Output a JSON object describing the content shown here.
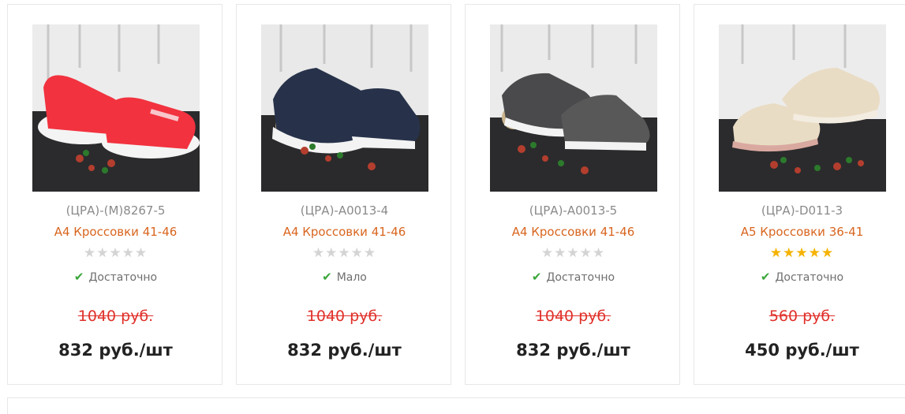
{
  "products": [
    {
      "sku": "(ЦРА)-(М)8267-5",
      "title": "А4 Кроссовки 41-46",
      "rating": 0,
      "stars_total": 5,
      "stock": "Достаточно",
      "old_price": "1040 руб.",
      "price": "832 руб./шт",
      "shoe_color": "#f2323f"
    },
    {
      "sku": "(ЦРА)-А0013-4",
      "title": "А4 Кроссовки 41-46",
      "rating": 0,
      "stars_total": 5,
      "stock": "Мало",
      "old_price": "1040 руб.",
      "price": "832 руб./шт",
      "shoe_color": "#27324a"
    },
    {
      "sku": "(ЦРА)-А0013-5",
      "title": "А4 Кроссовки 41-46",
      "rating": 0,
      "stars_total": 5,
      "stock": "Достаточно",
      "old_price": "1040 руб.",
      "price": "832 руб./шт",
      "shoe_color": "#4a4a4c"
    },
    {
      "sku": "(ЦРА)-D011-3",
      "title": "А5 Кроссовки 36-41",
      "rating": 5,
      "stars_total": 5,
      "stock": "Достаточно",
      "old_price": "560 руб.",
      "price": "450 руб./шт",
      "shoe_color": "#e9dcc4"
    }
  ],
  "colors": {
    "title": "#d8651e",
    "old_price": "#e0302a",
    "star_on": "#f5b301",
    "star_off": "#d4d4d4",
    "check": "#3aa63a"
  },
  "icons": {
    "check": "check-icon",
    "star": "star-icon"
  }
}
